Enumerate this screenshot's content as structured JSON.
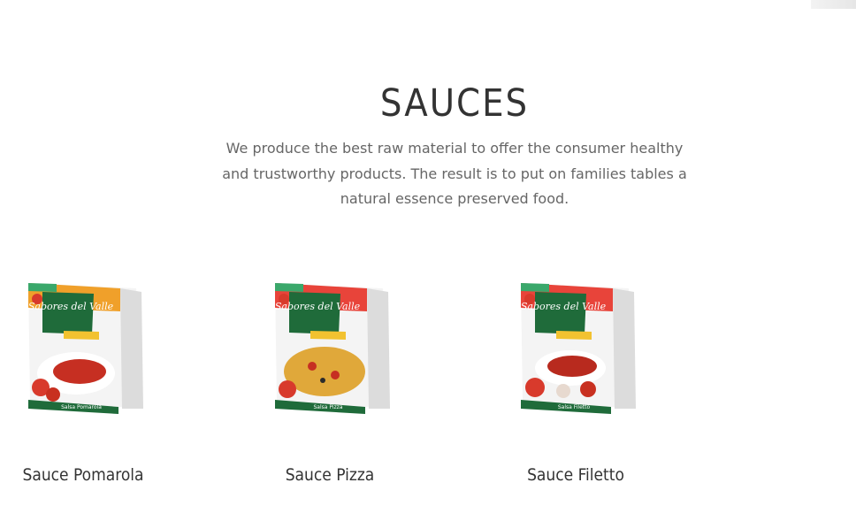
{
  "section": {
    "title": "SAUCES",
    "description": "We produce the best raw material to offer the consumer healthy and trustworthy products. The result is to put on families tables a natural essence preserved food."
  },
  "products": [
    {
      "name": "Sauce Pomarola",
      "image": {
        "brand_logo": "Sabores del Valle",
        "box_label": "Salsa Pomarola"
      }
    },
    {
      "name": "Sauce Pizza",
      "image": {
        "brand_logo": "Sabores del Valle",
        "box_label": "Salsa Pizza"
      }
    },
    {
      "name": "Sauce Filetto",
      "image": {
        "brand_logo": "Sabores del Valle",
        "box_label": "Salsa Filetto"
      }
    }
  ],
  "colors": {
    "heading": "#333333",
    "body_text": "#666666",
    "box_green": "#1f6b3a",
    "box_red": "#d83a2c",
    "box_orange": "#f0a02a"
  }
}
